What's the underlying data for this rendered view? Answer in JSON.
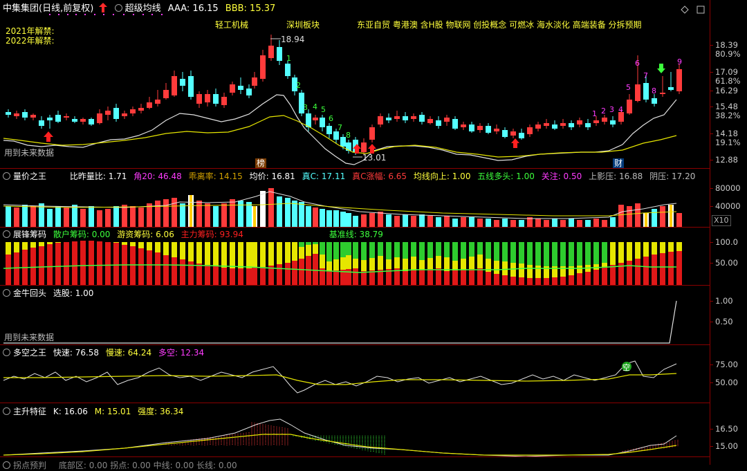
{
  "header": {
    "stock_name": "中集集团",
    "period": "(日线,前复权)",
    "arrow_icon": "red-up-arrow-icon",
    "indicator_name": "超级均线",
    "aaa": "AAA: 16.15",
    "bbb": "BBB: 15.37",
    "unlock_2021": "2021年解禁:",
    "unlock_2022": "2022年解禁:"
  },
  "tags": {
    "t1": "轻工机械",
    "t2": "深圳板块",
    "t3": "东亚自贸 粤港澳 含H股 物联网 创投概念 可燃冰 海水淡化 高端装备 分拆预期"
  },
  "main": {
    "high_label": "18.94",
    "low_label": "13.01",
    "future_data": "用到未来数据",
    "bang_label": "榜",
    "cai_label": "财",
    "count_down": [
      "1",
      "2",
      "3",
      "4",
      "5",
      "6",
      "7",
      "8"
    ],
    "count_up": [
      "1",
      "2",
      "3",
      "4",
      "5",
      "6",
      "7",
      "8",
      "9"
    ],
    "y_labels": [
      "18.39",
      "80.9%",
      "17.09",
      "61.8%",
      "16.29",
      "15.48",
      "38.2%",
      "14.18",
      "19.1%",
      "12.88"
    ],
    "colors": {
      "up": "#ff3b3b",
      "down": "#54ffff",
      "ma_white": "#e0e0e0",
      "ma_yellow": "#e6e600"
    }
  },
  "volume": {
    "title": "量价之王",
    "ratio": "比昨量比: 1.71",
    "j20": "角20: 46.48",
    "dev": "乖离率: 14.15",
    "avg": "均价: 16.81",
    "zhen_c": "真C: 17.11",
    "zhen_c_rise": "真C涨幅: 6.65",
    "ma_up": "均线向上: 1.00",
    "five_bull": "五线多头: 1.00",
    "focus": "关注: 0.50",
    "upper_shadow": "上影压: 16.88",
    "neg_press": "阴压: 17.20",
    "y_labels": [
      "80000",
      "40000"
    ],
    "x10": "X10"
  },
  "chips": {
    "title": "展锋筹码",
    "retail": "散户筹码: 0.00",
    "hot": "游资筹码: 6.06",
    "main": "主力筹码: 93.94",
    "base": "基准线: 38.79",
    "y_labels": [
      "100.0",
      "50.00"
    ]
  },
  "bull": {
    "title": "金牛回头",
    "pick": "选股: 1.00",
    "future_data": "用到未来数据",
    "y_labels": [
      "1.00",
      "0.50"
    ]
  },
  "dk": {
    "title": "多空之王",
    "fast": "快速: 76.58",
    "slow": "慢速: 64.24",
    "dk": "多空: 12.34",
    "marker": "空",
    "y_labels": [
      "75.00",
      "50.00"
    ]
  },
  "rise": {
    "title": "主升特征",
    "k": "K: 16.06",
    "m": "M: 15.01",
    "strength": "强度: 36.34",
    "y_labels": [
      "16.50",
      "15.00"
    ]
  },
  "bottom_partial": {
    "title": "拐点预判",
    "text": "底部区: 0.00   拐点: 0.00   中线: 0.00   长线: 0.00"
  }
}
